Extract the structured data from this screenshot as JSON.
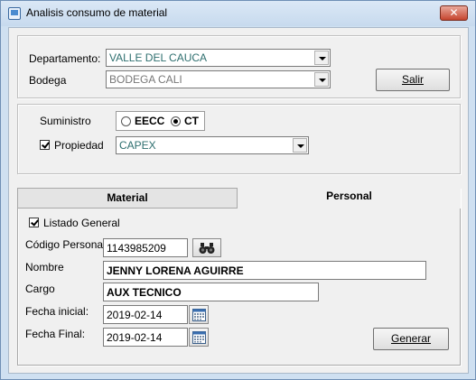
{
  "window": {
    "title": "Analisis consumo de material",
    "close_label": "✕"
  },
  "top": {
    "departamento_label": "Departamento:",
    "departamento_value": "VALLE DEL CAUCA",
    "bodega_label": "Bodega",
    "bodega_value": "BODEGA CALI",
    "salir_label": "Salir"
  },
  "middle": {
    "suministro_label": "Suministro",
    "radio_eecc_label": "EECC",
    "radio_ct_label": "CT",
    "selected_radio": "CT",
    "propiedad_label": "Propiedad",
    "propiedad_checked": true,
    "propiedad_value": "CAPEX"
  },
  "tabs": {
    "material_label": "Material",
    "personal_label": "Personal",
    "active": "Personal"
  },
  "personal": {
    "listado_general_label": "Listado General",
    "listado_general_checked": true,
    "codigo_label": "Código Personal",
    "codigo_value": "1143985209",
    "nombre_label": "Nombre",
    "nombre_value": "JENNY LORENA AGUIRRE",
    "cargo_label": "Cargo",
    "cargo_value": "AUX TECNICO",
    "fecha_inicial_label": "Fecha inicial:",
    "fecha_inicial_value": "2019-02-14",
    "fecha_final_label": "Fecha Final:",
    "fecha_final_value": "2019-02-14",
    "generar_label": "Generar"
  },
  "colors": {
    "titlebar": "#c7daee",
    "close_button": "#c5442e",
    "combo_text": "#2e6f6f",
    "client_bg": "#f0f0f0"
  },
  "icons": {
    "window_icon": "app-icon",
    "search": "binoculars-icon",
    "calendar": "calendar-icon"
  }
}
